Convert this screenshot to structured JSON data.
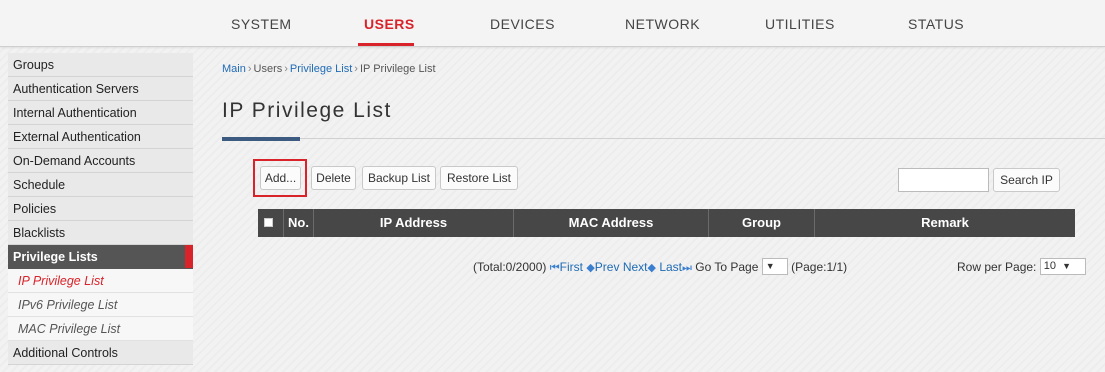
{
  "nav": {
    "items": [
      {
        "label": "SYSTEM"
      },
      {
        "label": "USERS"
      },
      {
        "label": "DEVICES"
      },
      {
        "label": "NETWORK"
      },
      {
        "label": "UTILITIES"
      },
      {
        "label": "STATUS"
      }
    ],
    "active_color": "#d9232a"
  },
  "sidebar": {
    "items": [
      {
        "label": "Groups"
      },
      {
        "label": "Authentication Servers"
      },
      {
        "label": "Internal Authentication"
      },
      {
        "label": "External Authentication"
      },
      {
        "label": "On-Demand Accounts"
      },
      {
        "label": "Schedule"
      },
      {
        "label": "Policies"
      },
      {
        "label": "Blacklists"
      },
      {
        "label": "Privilege Lists"
      },
      {
        "label": "Additional Controls"
      }
    ],
    "subitems": [
      {
        "label": "IP Privilege List"
      },
      {
        "label": "IPv6 Privilege List"
      },
      {
        "label": "MAC Privilege List"
      }
    ]
  },
  "breadcrumb": {
    "main": "Main",
    "sep": "›",
    "users": "Users",
    "privilege_list": "Privilege List",
    "current": "IP Privilege List"
  },
  "page": {
    "title": "IP Privilege List"
  },
  "toolbar": {
    "add_label": "Add...",
    "delete_label": "Delete",
    "backup_label": "Backup List",
    "restore_label": "Restore List",
    "search_value": "",
    "search_label": "Search IP"
  },
  "table": {
    "columns": [
      "No.",
      "IP Address",
      "MAC Address",
      "Group",
      "Remark"
    ],
    "rows": []
  },
  "pagination": {
    "total": "(Total:0/2000)",
    "first": "First",
    "prev": "Prev",
    "next": "Next",
    "last": "Last",
    "goto": "Go To Page",
    "goto_value": "",
    "page_info": "(Page:1/1)",
    "row_per_page_label": "Row per Page:",
    "row_per_page_value": "10"
  }
}
